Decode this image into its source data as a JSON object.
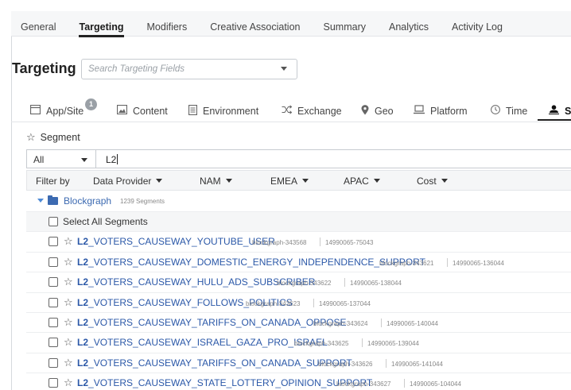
{
  "top_tabs": [
    "General",
    "Targeting",
    "Modifiers",
    "Creative Association",
    "Summary",
    "Analytics",
    "Activity Log"
  ],
  "active_top_tab": "Targeting",
  "targeting": {
    "title": "Targeting",
    "search_placeholder": "Search Targeting Fields"
  },
  "category_tabs": [
    {
      "label": "App/Site",
      "icon": "app-window-icon",
      "badge": "1"
    },
    {
      "label": "Content",
      "icon": "image-icon"
    },
    {
      "label": "Environment",
      "icon": "document-icon"
    },
    {
      "label": "Exchange",
      "icon": "shuffle-icon"
    },
    {
      "label": "Geo",
      "icon": "map-pin-icon"
    },
    {
      "label": "Platform",
      "icon": "laptop-icon"
    },
    {
      "label": "Time",
      "icon": "clock-icon"
    },
    {
      "label": "Se",
      "icon": "person-icon"
    }
  ],
  "segment": {
    "label": "Segment",
    "scope_select": "All",
    "query": "L2",
    "filter": {
      "label": "Filter by",
      "options": [
        "Data Provider",
        "NAM",
        "EMEA",
        "APAC",
        "Cost"
      ]
    },
    "group": {
      "name": "Blockgraph",
      "count": "1239 Segments"
    },
    "select_all": "Select All Segments",
    "items": [
      {
        "prefix": "L2",
        "rest": "_VOTERS_CAUSEWAY_YOUTUBE_USER",
        "id": "blockgraph-343568",
        "code": "14990065-75043"
      },
      {
        "prefix": "L2",
        "rest": "_VOTERS_CAUSEWAY_DOMESTIC_ENERGY_INDEPENDENCE_SUPPORT",
        "id": "blockgraph-343621",
        "code": "14990065-136044"
      },
      {
        "prefix": "L2",
        "rest": "_VOTERS_CAUSEWAY_HULU_ADS_SUBSCRIBER",
        "id": "blockgraph-343622",
        "code": "14990065-138044"
      },
      {
        "prefix": "L2",
        "rest": "_VOTERS_CAUSEWAY_FOLLOWS_POLITICS",
        "id": "blockgraph-343623",
        "code": "14990065-137044"
      },
      {
        "prefix": "L2",
        "rest": "_VOTERS_CAUSEWAY_TARIFFS_ON_CANADA_OPPOSE",
        "id": "blockgraph-343624",
        "code": "14990065-140044"
      },
      {
        "prefix": "L2",
        "rest": "_VOTERS_CAUSEWAY_ISRAEL_GAZA_PRO_ISRAEL",
        "id": "blockgraph-343625",
        "code": "14990065-139044"
      },
      {
        "prefix": "L2",
        "rest": "_VOTERS_CAUSEWAY_TARIFFS_ON_CANADA_SUPPORT",
        "id": "blockgraph-343626",
        "code": "14990065-141044"
      },
      {
        "prefix": "L2",
        "rest": "_VOTERS_CAUSEWAY_STATE_LOTTERY_OPINION_SUPPORT",
        "id": "blockgraph-343627",
        "code": "14990065-104044"
      }
    ]
  }
}
